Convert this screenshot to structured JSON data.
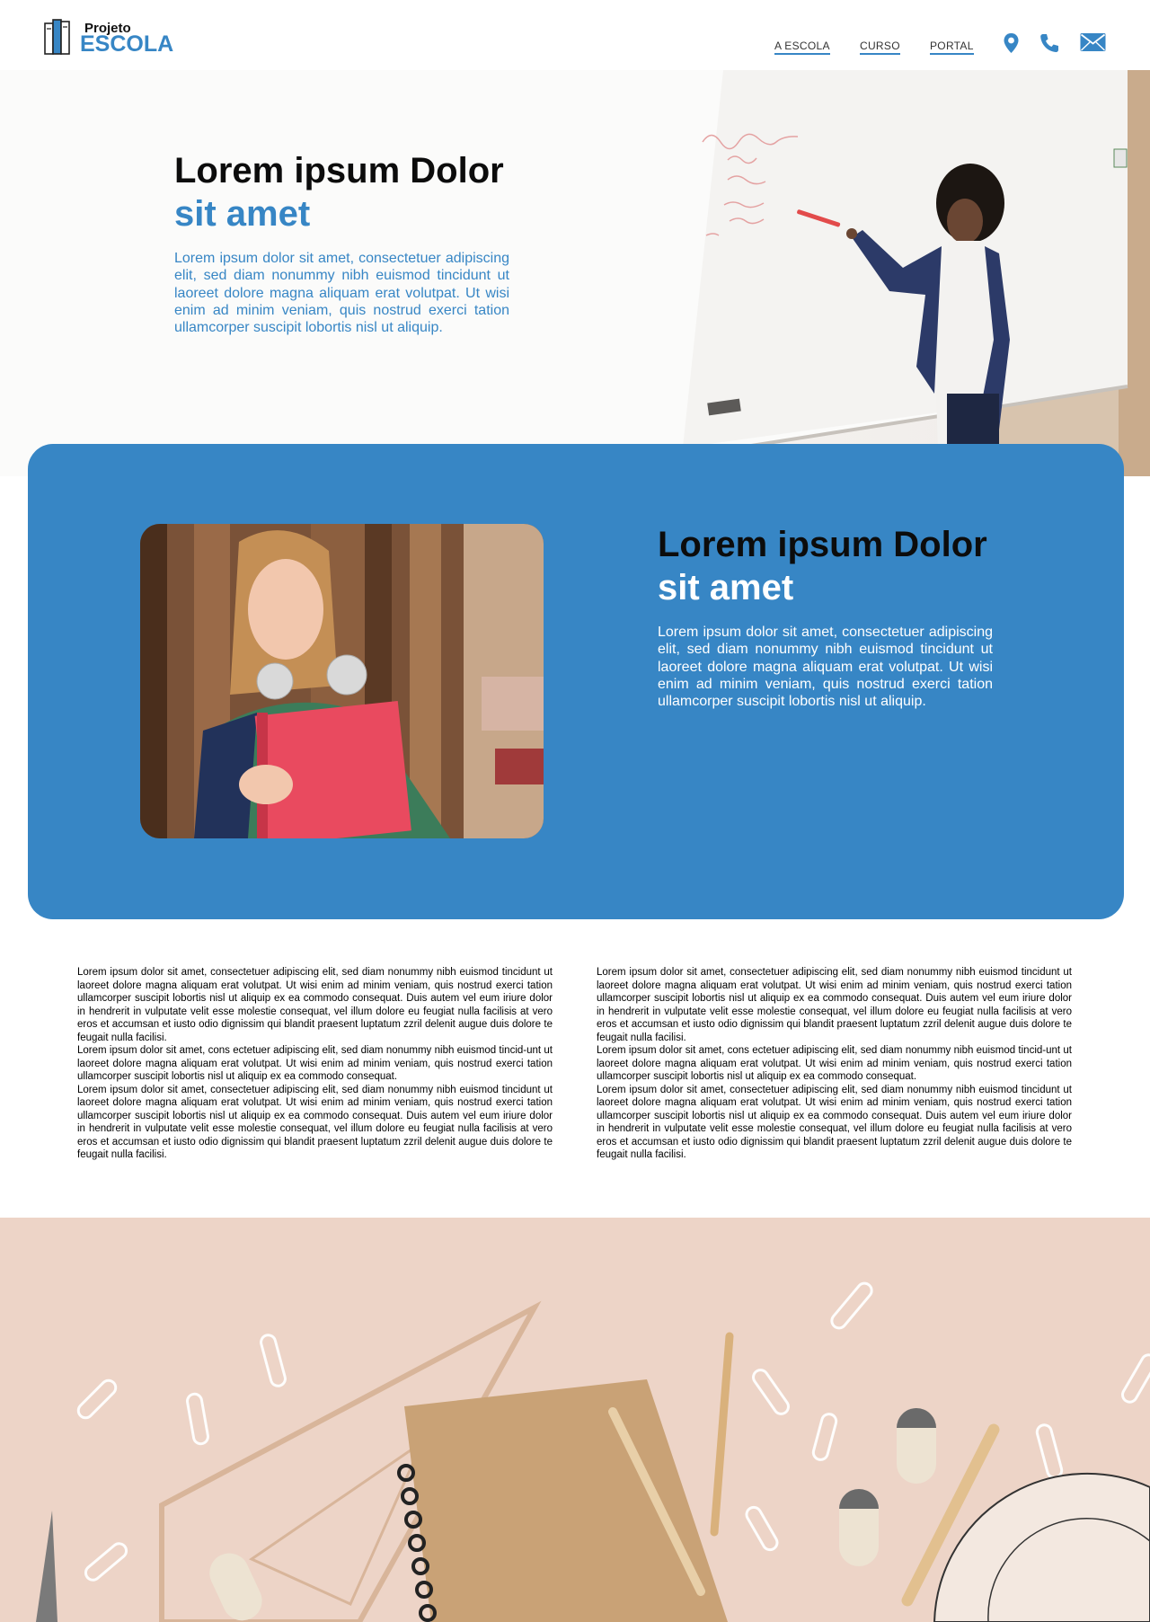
{
  "header": {
    "logo_top": "Projeto",
    "logo_bottom": "ESCOLA",
    "nav": [
      "A ESCOLA",
      "CURSO",
      "PORTAL"
    ],
    "icons": [
      "location-icon",
      "phone-icon",
      "mail-icon"
    ]
  },
  "hero": {
    "title_line1": "Lorem ipsum Dolor",
    "title_line2": "sit amet",
    "text": "Lorem ipsum dolor sit amet, consectetuer adipiscing elit, sed diam nonummy nibh euismod tincidunt ut laoreet dolore magna aliquam erat volutpat. Ut wisi enim ad minim veniam, quis nostrud exerci tation ullamcorper suscipit lobortis nisl ut aliquip."
  },
  "card": {
    "title_line1": "Lorem ipsum Dolor",
    "title_line2": "sit amet",
    "text": "Lorem ipsum dolor sit amet, consectetuer adipiscing elit, sed diam nonummy nibh euismod tincidunt ut laoreet dolore magna aliquam erat volutpat. Ut wisi enim ad minim veniam, quis nostrud exerci tation ullamcorper suscipit lobortis nisl ut aliquip."
  },
  "columns": {
    "left": [
      "Lorem ipsum dolor sit amet, consectetuer adipiscing elit, sed diam nonummy nibh euismod tincidunt ut laoreet dolore magna aliquam erat volutpat. Ut wisi enim ad minim veniam, quis nostrud exerci tation ullamcorper suscipit lobortis nisl ut aliquip ex ea commodo consequat. Duis autem vel eum iriure dolor in hendrerit in vulputate velit esse molestie consequat, vel illum dolore eu feugiat nulla facilisis at vero eros et accumsan et iusto odio dignissim qui blandit praesent luptatum zzril delenit augue duis dolore te feugait nulla facilisi.",
      "Lorem ipsum dolor sit amet, cons ectetuer adipiscing elit, sed diam nonummy nibh euismod tincid-unt ut laoreet dolore magna aliquam erat volutpat. Ut wisi enim ad minim veniam, quis nostrud exerci tation ullamcorper suscipit lobortis nisl ut aliquip ex ea commodo consequat.",
      "Lorem ipsum dolor sit amet, consectetuer adipiscing elit, sed diam nonummy nibh euismod tincidunt ut laoreet dolore magna aliquam erat volutpat. Ut wisi enim ad minim veniam, quis nostrud exerci tation ullamcorper suscipit lobortis nisl ut aliquip ex ea commodo consequat. Duis autem vel eum iriure dolor in hendrerit in vulputate velit esse molestie consequat, vel illum dolore eu feugiat nulla facilisis at vero eros et accumsan et iusto odio dignissim qui blandit praesent luptatum zzril delenit augue duis dolore te feugait nulla facilisi."
    ],
    "right": [
      "Lorem ipsum dolor sit amet, consectetuer adipiscing elit, sed diam nonummy nibh euismod tincidunt ut laoreet dolore magna aliquam erat volutpat. Ut wisi enim ad minim veniam, quis nostrud exerci tation ullamcorper suscipit lobortis nisl ut aliquip ex ea commodo consequat. Duis autem vel eum iriure dolor in hendrerit in vulputate velit esse molestie consequat, vel illum dolore eu feugiat nulla facilisis at vero eros et accumsan et iusto odio dignissim qui blandit praesent luptatum zzril delenit augue duis dolore te feugait nulla facilisi.",
      "Lorem ipsum dolor sit amet, cons ectetuer adipiscing elit, sed diam nonummy nibh euismod tincid-unt ut laoreet dolore magna aliquam erat volutpat. Ut wisi enim ad minim veniam, quis nostrud exerci tation ullamcorper suscipit lobortis nisl ut aliquip ex ea commodo consequat.",
      "Lorem ipsum dolor sit amet, consectetuer adipiscing elit, sed diam nonummy nibh euismod tincidunt ut laoreet dolore magna aliquam erat volutpat. Ut wisi enim ad minim veniam, quis nostrud exerci tation ullamcorper suscipit lobortis nisl ut aliquip ex ea commodo consequat. Duis autem vel eum iriure dolor in hendrerit in vulputate velit esse molestie consequat, vel illum dolore eu feugiat nulla facilisis at vero eros et accumsan et iusto odio dignissim qui blandit praesent luptatum zzril delenit augue duis dolore te feugait nulla facilisi."
    ]
  },
  "colors": {
    "accent": "#3786c5",
    "heading": "#0c0c0c",
    "nav_text": "#333333"
  }
}
